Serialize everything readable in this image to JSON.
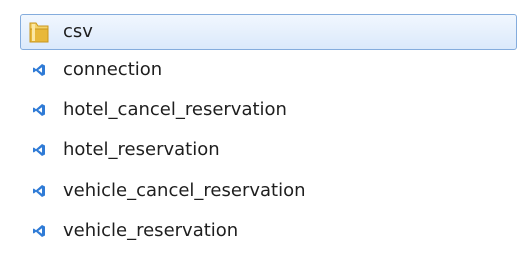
{
  "items": [
    {
      "label": "csv",
      "type": "folder",
      "icon": "folder-icon",
      "selected": true
    },
    {
      "label": "connection",
      "type": "file",
      "icon": "vscode-file-icon",
      "selected": false
    },
    {
      "label": "hotel_cancel_reservation",
      "type": "file",
      "icon": "vscode-file-icon",
      "selected": false
    },
    {
      "label": "hotel_reservation",
      "type": "file",
      "icon": "vscode-file-icon",
      "selected": false
    },
    {
      "label": "vehicle_cancel_reservation",
      "type": "file",
      "icon": "vscode-file-icon",
      "selected": false
    },
    {
      "label": "vehicle_reservation",
      "type": "file",
      "icon": "vscode-file-icon",
      "selected": false
    }
  ],
  "colors": {
    "selection_border": "#84acdd",
    "selection_fill": "#dbe9fb",
    "folder": "#e8b83a",
    "file_icon": "#2f7bd6"
  }
}
